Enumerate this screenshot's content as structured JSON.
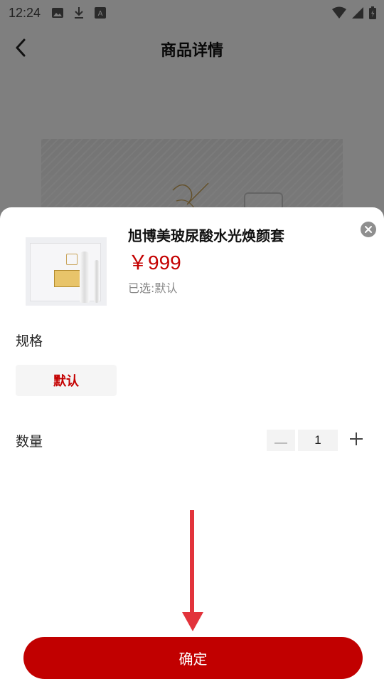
{
  "status_bar": {
    "time": "12:24",
    "icons": [
      "image-icon",
      "download-icon",
      "font-icon",
      "wifi-icon",
      "signal-icon",
      "battery-icon"
    ]
  },
  "header": {
    "title": "商品详情",
    "back_icon": "chevron-left-icon"
  },
  "sheet": {
    "product_name": "旭博美玻尿酸水光焕颜套",
    "price": "￥999",
    "selected_text": "已选:默认",
    "close_icon": "close-icon",
    "spec": {
      "heading": "规格",
      "options": [
        "默认"
      ],
      "selected": "默认"
    },
    "quantity": {
      "heading": "数量",
      "value": "1",
      "minus_icon": "minus-icon",
      "plus_icon": "plus-icon"
    },
    "confirm_label": "确定"
  },
  "colors": {
    "accent": "#c10000",
    "price": "#c40000",
    "overlay": "rgba(0,0,0,0.5)",
    "annotation_arrow": "#e2333b"
  }
}
